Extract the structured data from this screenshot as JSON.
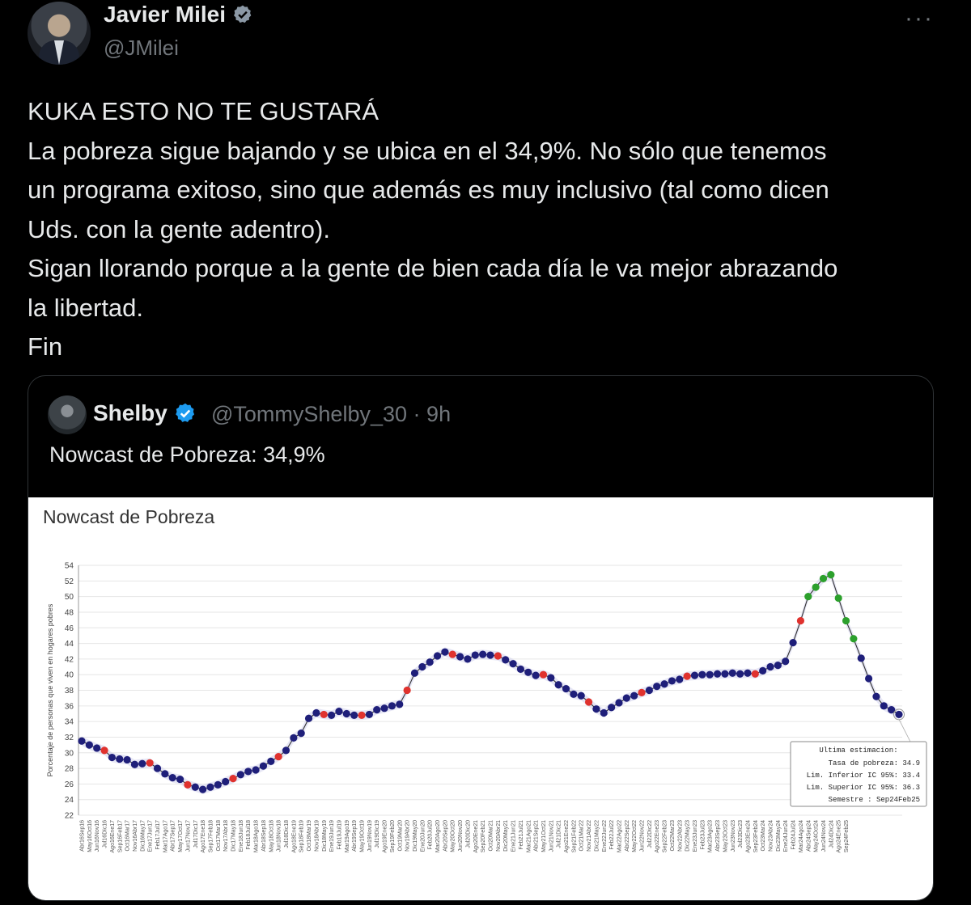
{
  "author": {
    "name": "Javier Milei",
    "handle": "@JMilei",
    "more_icon": "more-dots-icon"
  },
  "tweet": {
    "lines": [
      "KUKA ESTO NO TE GUSTARÁ",
      "La pobreza sigue bajando y se ubica en el 34,9%. No sólo que tenemos",
      "un programa exitoso, sino que además es muy inclusivo (tal como dicen",
      "Uds. con la gente adentro).",
      "Sigan llorando porque a la gente de bien cada día le va mejor abrazando",
      "la libertad.",
      "Fin"
    ]
  },
  "quote": {
    "name": "Shelby",
    "handle": "@TommyShelby_30",
    "separator": "·",
    "time": "9h",
    "text": "Nowcast de Pobreza: 34,9%"
  },
  "colors": {
    "verified": "#1d9bf0",
    "blue_point": "#1f1f7a",
    "red_point": "#e0322e",
    "green_point": "#2ca02c"
  },
  "chart_data": {
    "type": "line",
    "title": "Nowcast de Pobreza",
    "ylabel": "Porcentaje de personas que viven en hogares pobres",
    "ylim": [
      22,
      54
    ],
    "yticks": [
      22,
      24,
      26,
      28,
      30,
      32,
      34,
      36,
      38,
      40,
      42,
      44,
      46,
      48,
      50,
      52,
      54
    ],
    "x": [
      "Abr16Sep16",
      "May16Oct16",
      "Jun16Nov16",
      "Jul16Dic16",
      "Ago16Ene17",
      "Sep16Feb17",
      "Oct16Mar17",
      "Nov16Abr17",
      "Dic16May17",
      "Ene17Jun17",
      "Feb17Jul17",
      "Mar17Ago17",
      "Abr17Sep17",
      "May17Oct17",
      "Jun17Nov17",
      "Jul17Dic17",
      "Ago17Ene18",
      "Sep17Feb18",
      "Oct17Mar18",
      "Nov17Abr18",
      "Dic17May18",
      "Ene18Jun18",
      "Feb18Jul18",
      "Mar18Ago18",
      "Abr18Sep18",
      "May18Oct18",
      "Jun18Nov18",
      "Jul18Dic18",
      "Ago18Ene19",
      "Sep18Feb19",
      "Oct18Mar19",
      "Nov18Abr19",
      "Dic18May19",
      "Ene19Jun19",
      "Feb19Jul19",
      "Mar19Ago19",
      "Abr19Sep19",
      "May19Oct19",
      "Jun19Nov19",
      "Jul19Dic19",
      "Ago19Ene20",
      "Sep19Feb20",
      "Oct19Mar20",
      "Nov19Abr20",
      "Dic19May20",
      "Ene20Jun20",
      "Feb20Jul20",
      "Mar20Ago20",
      "Abr20Sep20",
      "May20Oct20",
      "Jun20Nov20",
      "Jul20Dic20",
      "Ago20Ene21",
      "Sep20Feb21",
      "Oct20Mar21",
      "Nov20Abr21",
      "Dic20May21",
      "Ene21Jun21",
      "Feb21Jul21",
      "Mar21Ago21",
      "Abr21Sep21",
      "May21Oct21",
      "Jun21Nov21",
      "Jul21Dic21",
      "Ago21Ene22",
      "Sep21Feb22",
      "Oct21Mar22",
      "Nov21Abr22",
      "Dic21May22",
      "Ene22Jun22",
      "Feb22Jul22",
      "Mar22Ago22",
      "Abr22Sep22",
      "May22Oct22",
      "Jun22Nov22",
      "Jul22Dic22",
      "Ago22Ene23",
      "Sep22Feb23",
      "Oct22Mar23",
      "Nov22Abr23",
      "Dic22May23",
      "Ene23Jun23",
      "Feb23Jul23",
      "Mar23Ago23",
      "Abr23Sep23",
      "May23Oct23",
      "Jun23Nov23",
      "Jul23Dic23",
      "Ago23Ene24",
      "Sep23Feb24",
      "Oct23Mar24",
      "Nov23Abr24",
      "Dic23May24",
      "Ene24Jun24",
      "Feb24Jul24",
      "Mar24Ago24",
      "Abr24Sep24",
      "May24Oct24",
      "Jun24Nov24",
      "Jul24Dic24",
      "Ago24Ene25",
      "Sep24Feb25"
    ],
    "values": [
      31.5,
      31.0,
      30.6,
      30.3,
      29.4,
      29.2,
      29.1,
      28.5,
      28.6,
      28.7,
      28.0,
      27.3,
      26.8,
      26.6,
      25.9,
      25.6,
      25.3,
      25.6,
      25.9,
      26.3,
      26.7,
      27.2,
      27.6,
      27.8,
      28.3,
      28.9,
      29.5,
      30.3,
      31.9,
      32.5,
      34.4,
      35.1,
      34.9,
      34.8,
      35.3,
      35.0,
      34.8,
      34.8,
      34.9,
      35.5,
      35.7,
      36.0,
      36.2,
      38.0,
      40.2,
      41.0,
      41.6,
      42.4,
      42.9,
      42.6,
      42.3,
      42.0,
      42.5,
      42.6,
      42.5,
      42.4,
      41.9,
      41.4,
      40.7,
      40.3,
      39.9,
      40.0,
      39.6,
      38.7,
      38.2,
      37.5,
      37.3,
      36.5,
      35.6,
      35.1,
      35.8,
      36.4,
      37.0,
      37.3,
      37.7,
      38.0,
      38.5,
      38.8,
      39.2,
      39.4,
      39.8,
      39.9,
      40.0,
      40.0,
      40.1,
      40.1,
      40.2,
      40.1,
      40.2,
      40.1,
      40.5,
      41.0,
      41.2,
      41.7,
      44.1,
      46.9,
      50.0,
      51.2,
      52.3,
      52.8,
      49.8,
      46.9,
      44.6,
      42.1,
      39.5,
      37.2,
      36.0,
      35.5,
      34.9
    ],
    "point_colors": [
      "b",
      "b",
      "b",
      "r",
      "b",
      "b",
      "b",
      "b",
      "b",
      "r",
      "b",
      "b",
      "b",
      "b",
      "r",
      "b",
      "b",
      "b",
      "b",
      "b",
      "r",
      "b",
      "b",
      "b",
      "b",
      "b",
      "r",
      "b",
      "b",
      "b",
      "b",
      "b",
      "r",
      "b",
      "b",
      "b",
      "b",
      "r",
      "b",
      "b",
      "b",
      "b",
      "b",
      "r",
      "b",
      "b",
      "b",
      "b",
      "b",
      "r",
      "b",
      "b",
      "b",
      "b",
      "b",
      "r",
      "b",
      "b",
      "b",
      "b",
      "b",
      "r",
      "b",
      "b",
      "b",
      "b",
      "b",
      "r",
      "b",
      "b",
      "b",
      "b",
      "b",
      "b",
      "r",
      "b",
      "b",
      "b",
      "b",
      "b",
      "r",
      "b",
      "b",
      "b",
      "b",
      "b",
      "b",
      "b",
      "b",
      "r",
      "b",
      "b",
      "b",
      "b",
      "b",
      "r",
      "g",
      "g",
      "g",
      "g",
      "g",
      "g",
      "g"
    ],
    "tooltip": {
      "title": "Ultima estimacion:",
      "rows": [
        "Tasa de pobreza:  34.9",
        "Lim. Inferior IC 95%:  33.4",
        "Lim. Superior IC 95%:  36.3",
        "Semestre : Sep24Feb25"
      ]
    },
    "grid": true,
    "legend": "none"
  }
}
